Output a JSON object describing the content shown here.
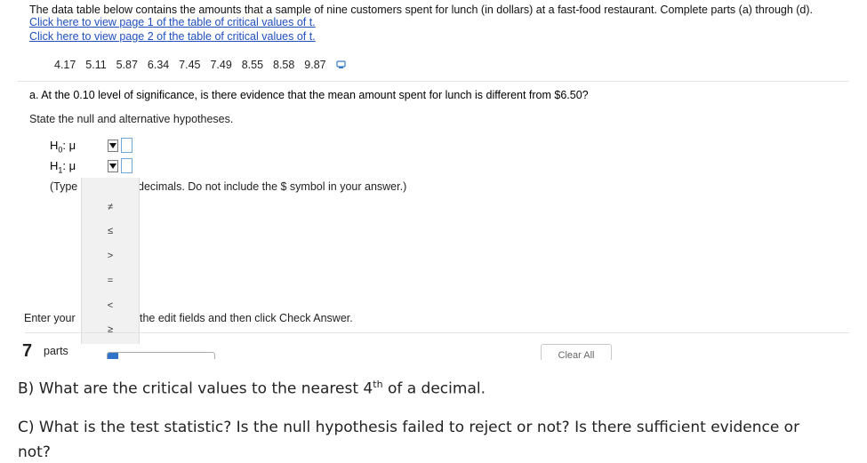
{
  "intro": "The data table below contains the amounts that a sample of nine customers spent for lunch (in dollars) at a fast-food restaurant. Complete parts (a) through (d).",
  "links": [
    "Click here to view page 1 of the table of critical values of t.",
    "Click here to view page 2 of the table of critical values of t."
  ],
  "data_values": [
    "4.17",
    "5.11",
    "5.87",
    "6.34",
    "7.45",
    "7.49",
    "8.55",
    "8.58",
    "9.87"
  ],
  "data_text": "4.17  5.11  5.87  6.34  7.45  7.49  8.55  8.58  9.87",
  "icon_copy": "copy-data-icon",
  "question_a": "a. At the 0.10 level of significance, is there evidence that the mean amount spent for lunch is different from $6.50?",
  "state_prompt": "State the null and alternative hypotheses.",
  "hypotheses": {
    "h0": {
      "symbol": "H",
      "sub": "0",
      "rest": ": μ"
    },
    "h1": {
      "symbol": "H",
      "sub": "1",
      "rest": ": μ"
    }
  },
  "type_prefix": "(Type",
  "type_suffix": "decimals. Do not include the $ symbol in your answer.)",
  "dropdown_options": [
    "≠",
    "≤",
    ">",
    "=",
    "<",
    "≥"
  ],
  "enter_prefix": "Enter your",
  "enter_suffix": "the edit fields and then click Check Answer.",
  "parts": {
    "count": "7",
    "label": "parts",
    "progress_fraction": 0.1
  },
  "clear_all": "Clear All",
  "question_b": {
    "pre": "B) What are the critical values to the nearest 4",
    "sup": "th",
    "post": " of a decimal."
  },
  "question_c_line1": "C) What is the test statistic? Is the null hypothesis failed to reject or not? Is there sufficient evidence or",
  "question_c_line2": "not?",
  "colors": {
    "link": "#1f4fbf",
    "accent": "#2f74c8",
    "input_border": "#6fa6d6"
  }
}
